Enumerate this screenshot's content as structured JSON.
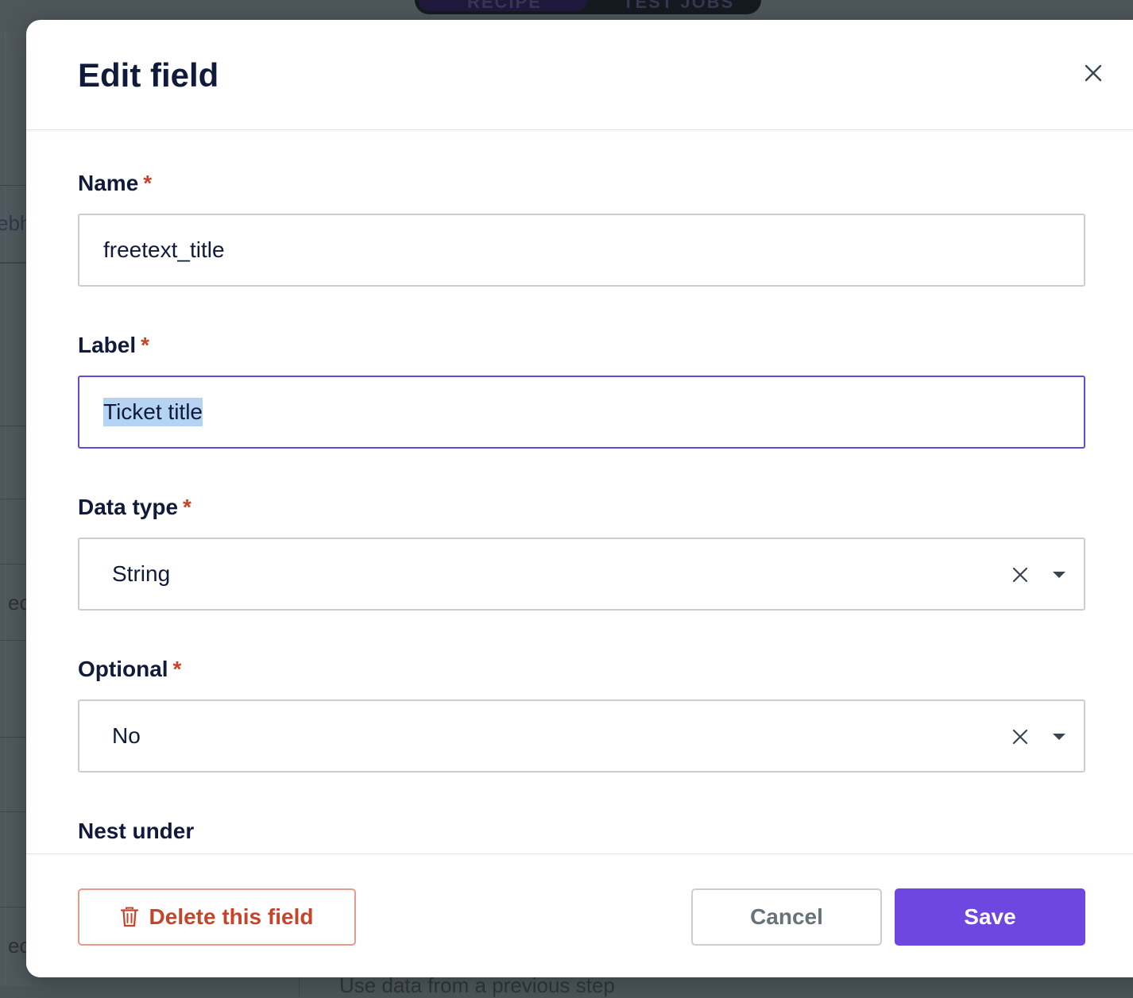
{
  "background": {
    "tabs": [
      "RECIPE",
      "TEST JOBS"
    ],
    "fragments": [
      "ebh",
      "ec",
      "ec"
    ],
    "bottom_text": "Use data from a previous step"
  },
  "modal": {
    "title": "Edit field",
    "close_icon": "close-icon"
  },
  "fields": {
    "name": {
      "label": "Name",
      "required_mark": "*",
      "value": "freetext_title"
    },
    "label": {
      "label": "Label",
      "required_mark": "*",
      "value": "Ticket title"
    },
    "data_type": {
      "label": "Data type",
      "required_mark": "*",
      "value": "String"
    },
    "optional": {
      "label": "Optional",
      "required_mark": "*",
      "value": "No"
    },
    "nest_under": {
      "label": "Nest under"
    }
  },
  "footer": {
    "delete_label": "Delete this field",
    "cancel_label": "Cancel",
    "save_label": "Save"
  },
  "colors": {
    "accent": "#6d47e0",
    "danger": "#c6452a",
    "focus_border": "#6b47d6",
    "selection": "#b5d3f2"
  }
}
